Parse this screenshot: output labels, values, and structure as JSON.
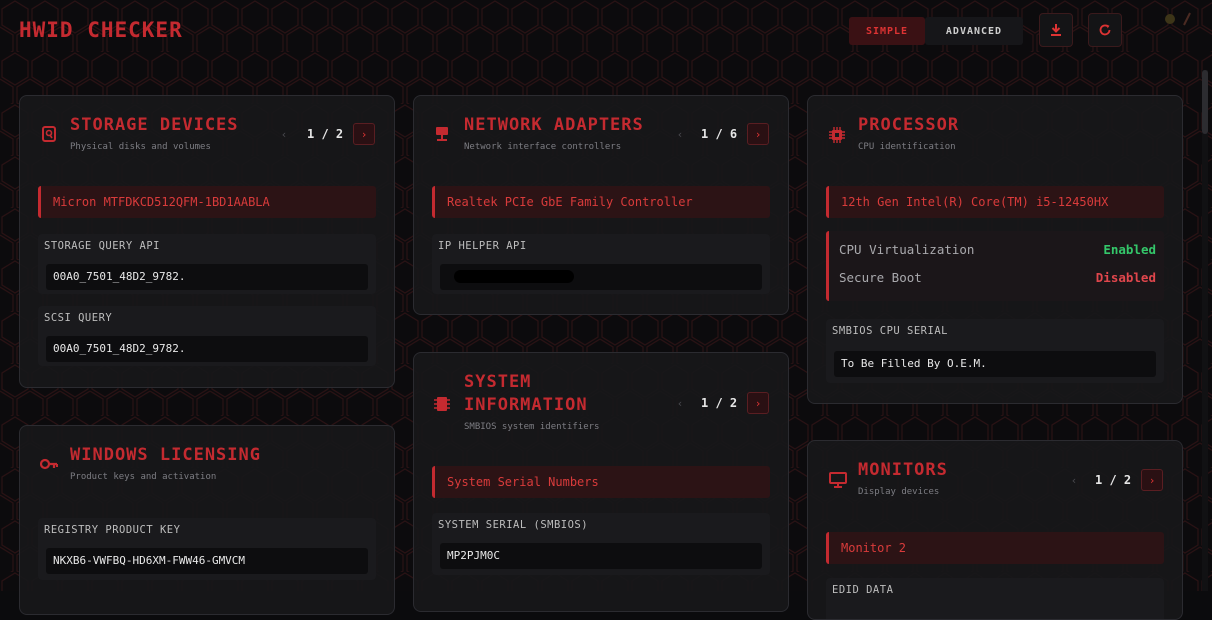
{
  "app": {
    "title": "HWID CHECKER"
  },
  "header": {
    "modes": [
      "SIMPLE",
      "ADVANCED"
    ],
    "active_mode": "SIMPLE",
    "icons": [
      "download-icon",
      "refresh-icon"
    ]
  },
  "colors": {
    "accent": "#c42a30",
    "enabled": "#34c76a",
    "disabled": "#e0464c",
    "background": "#0b0b0d",
    "card": "#17171a"
  },
  "cards": {
    "storage": {
      "icon": "hard-drive-icon",
      "title": "STORAGE DEVICES",
      "subtitle": "Physical disks and volumes",
      "pager": "1 / 2",
      "device": "Micron MTFDKCD512QFM-1BD1AABLA",
      "fields": [
        {
          "label": "STORAGE QUERY API",
          "value": "00A0_7501_48D2_9782."
        },
        {
          "label": "SCSI QUERY",
          "value": "00A0_7501_48D2_9782."
        }
      ]
    },
    "network": {
      "icon": "network-icon",
      "title": "NETWORK ADAPTERS",
      "subtitle": "Network interface controllers",
      "pager": "1 / 6",
      "device": "Realtek PCIe GbE Family Controller",
      "fields": [
        {
          "label": "IP HELPER API",
          "value": ""
        }
      ]
    },
    "processor": {
      "icon": "cpu-chip-icon",
      "title": "PROCESSOR",
      "subtitle": "CPU identification",
      "device": "12th Gen Intel(R) Core(TM) i5-12450HX",
      "toggles": [
        {
          "label": "CPU Virtualization",
          "value": "Enabled",
          "state": "on"
        },
        {
          "label": "Secure Boot",
          "value": "Disabled",
          "state": "off"
        }
      ],
      "fields": [
        {
          "label": "SMBIOS CPU SERIAL",
          "value": "To Be Filled By O.E.M."
        }
      ]
    },
    "licensing": {
      "icon": "key-icon",
      "title": "WINDOWS LICENSING",
      "subtitle": "Product keys and activation",
      "fields": [
        {
          "label": "REGISTRY PRODUCT KEY",
          "value": "NKXB6-VWFBQ-HD6XM-FWW46-GMVCM"
        }
      ]
    },
    "system": {
      "icon": "memory-icon",
      "title_lines": [
        "SYSTEM",
        "INFORMATION"
      ],
      "subtitle": "SMBIOS system identifiers",
      "pager": "1 / 2",
      "device": "System Serial Numbers",
      "fields": [
        {
          "label": "SYSTEM SERIAL (SMBIOS)",
          "value": "MP2PJM0C"
        }
      ]
    },
    "monitors": {
      "icon": "monitor-icon",
      "title": "MONITORS",
      "subtitle": "Display devices",
      "pager": "1 / 2",
      "device": "Monitor 2",
      "fields": [
        {
          "label": "EDID DATA",
          "value": ""
        }
      ]
    }
  }
}
